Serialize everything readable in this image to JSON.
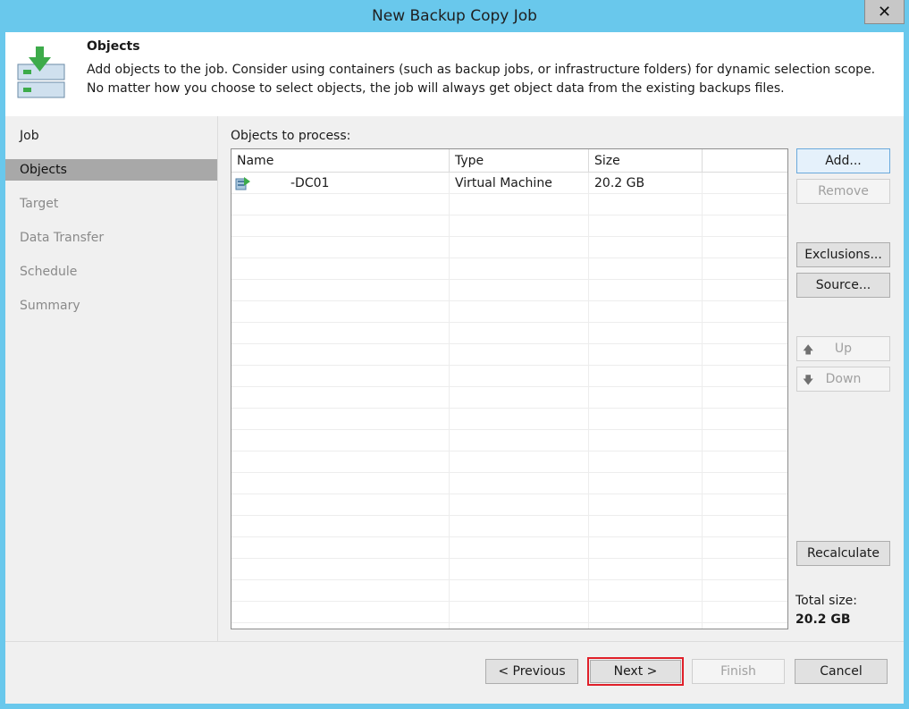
{
  "window": {
    "title": "New Backup Copy Job",
    "close_glyph": "✕"
  },
  "header": {
    "title": "Objects",
    "description": "Add objects to the job. Consider using containers (such as backup jobs, or infrastructure folders) for dynamic selection scope. No matter how you choose to select objects, the job will always get object data from the existing backups files.",
    "icon": "backup-copy-download-icon"
  },
  "nav": {
    "items": [
      {
        "label": "Job",
        "state": "done"
      },
      {
        "label": "Objects",
        "state": "active"
      },
      {
        "label": "Target",
        "state": "pending"
      },
      {
        "label": "Data Transfer",
        "state": "pending"
      },
      {
        "label": "Schedule",
        "state": "pending"
      },
      {
        "label": "Summary",
        "state": "pending"
      }
    ]
  },
  "objects": {
    "label": "Objects to process:",
    "columns": [
      "Name",
      "Type",
      "Size"
    ],
    "rows": [
      {
        "name": "-DC01",
        "type": "Virtual Machine",
        "size": "20.2 GB",
        "icon": "virtual-machine-icon"
      }
    ]
  },
  "side_buttons": {
    "add": "Add...",
    "remove": "Remove",
    "exclusions": "Exclusions...",
    "source": "Source...",
    "up": "Up",
    "down": "Down",
    "recalculate": "Recalculate",
    "up_glyph": "🡅",
    "down_glyph": "🡇"
  },
  "total": {
    "label": "Total size:",
    "value": "20.2 GB"
  },
  "footer": {
    "previous": "< Previous",
    "next": "Next >",
    "finish": "Finish",
    "cancel": "Cancel"
  },
  "colors": {
    "title_bar": "#69c8ec",
    "nav_active": "#a8a8a8",
    "highlight": "#e0202a",
    "icon_green": "#3dab4a"
  }
}
